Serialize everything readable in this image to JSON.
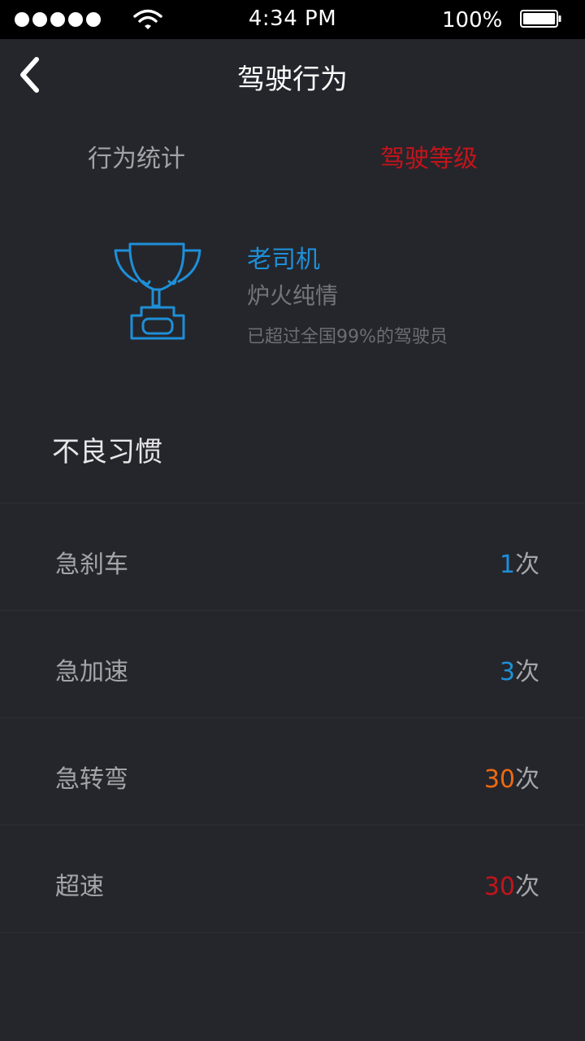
{
  "status_bar": {
    "time": "4:34 PM",
    "battery_percent": "100%",
    "signal_bars": 5,
    "signal_icon": "signal-dots-icon",
    "wifi_icon": "wifi-icon",
    "battery_icon": "battery-full-icon"
  },
  "nav": {
    "back_icon": "chevron-left-icon",
    "title": "驾驶行为"
  },
  "tabs": [
    {
      "label": "行为统计",
      "active": false,
      "color": "#a2a3a7"
    },
    {
      "label": "驾驶等级",
      "active": true,
      "color": "#c4141b"
    }
  ],
  "level": {
    "icon": "trophy-icon",
    "title": "老司机",
    "subtitle": "炉火纯情",
    "note": "已超过全国99%的驾驶员"
  },
  "habits": {
    "title": "不良习惯",
    "items": [
      {
        "label": "急刹车",
        "count": "1",
        "unit": "次",
        "color": "#1e8fd8"
      },
      {
        "label": "急加速",
        "count": "3",
        "unit": "次",
        "color": "#1e8fd8"
      },
      {
        "label": "急转弯",
        "count": "30",
        "unit": "次",
        "color": "#ee6a12"
      },
      {
        "label": "超速",
        "count": "30",
        "unit": "次",
        "color": "#c4141b"
      }
    ]
  },
  "colors": {
    "background": "#25262b",
    "accent_blue": "#1e8fd8",
    "accent_red": "#c4141b",
    "accent_orange": "#ee6a12"
  }
}
